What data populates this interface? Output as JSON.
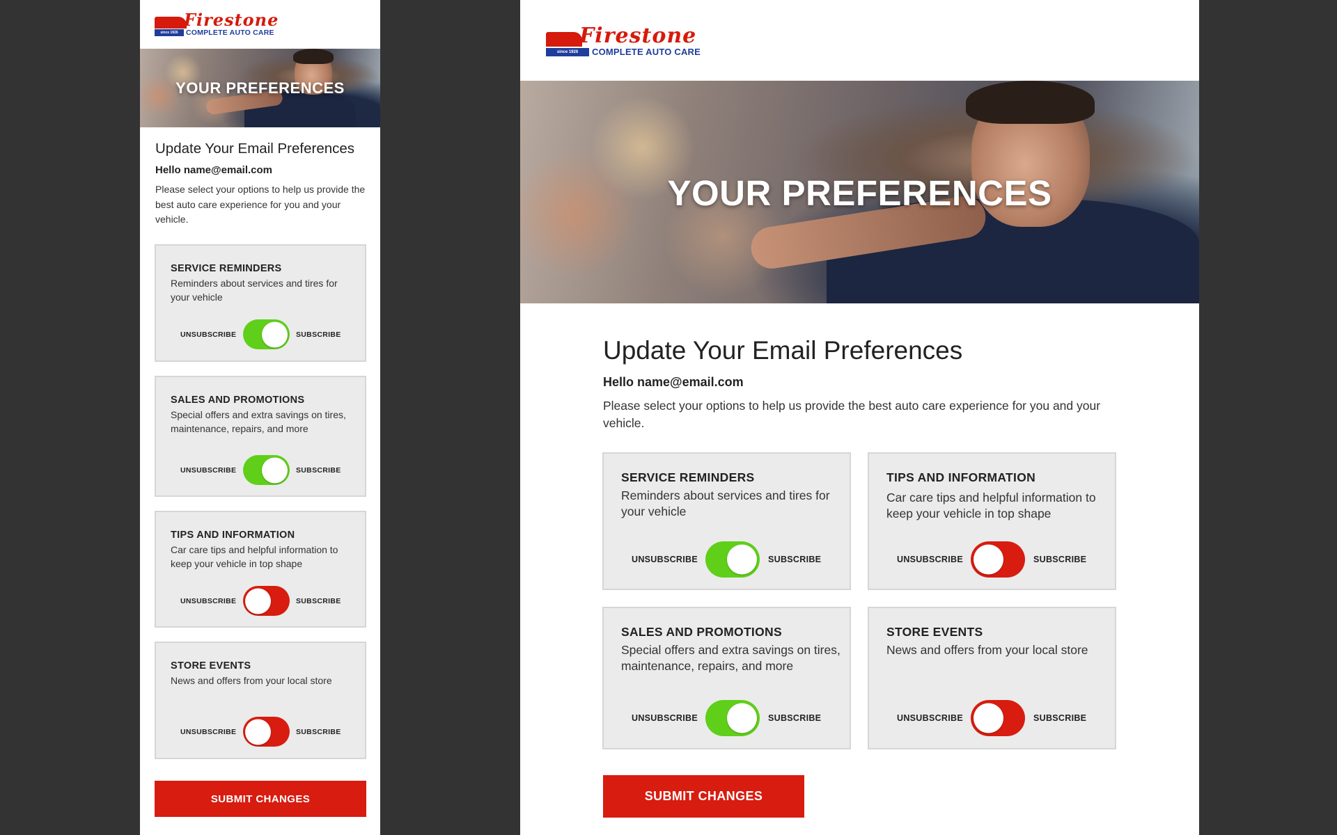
{
  "brand": {
    "name": "Firestone",
    "since": "since 1926",
    "tagline": "COMPLETE AUTO CARE",
    "colors": {
      "red": "#d61a0c",
      "blue": "#1f3d9b",
      "toggle_on": "#5fcf1a",
      "toggle_off": "#d81c10"
    }
  },
  "hero": {
    "title": "YOUR PREFERENCES"
  },
  "page": {
    "heading": "Update Your Email Preferences",
    "greeting": "Hello name@email.com",
    "intro": "Please select your options to help us provide the best auto care experience for you and your vehicle."
  },
  "toggle_labels": {
    "off": "UNSUBSCRIBE",
    "on": "SUBSCRIBE"
  },
  "preferences": {
    "service": {
      "title": "SERVICE REMINDERS",
      "description": "Reminders about services and tires for your vehicle",
      "subscribed": true
    },
    "sales": {
      "title": "SALES AND PROMOTIONS",
      "description": "Special offers and extra savings on tires, maintenance, repairs, and more",
      "subscribed": true
    },
    "tips": {
      "title": "TIPS AND INFORMATION",
      "description": "Car care tips and helpful information to keep your vehicle in top shape",
      "subscribed": false
    },
    "events": {
      "title": "STORE EVENTS",
      "description": "News and offers from your local store",
      "subscribed": false
    }
  },
  "submit_label": "SUBMIT CHANGES",
  "icons": {
    "toggle": "toggle-switch-icon",
    "logo": "firestone-logo"
  }
}
